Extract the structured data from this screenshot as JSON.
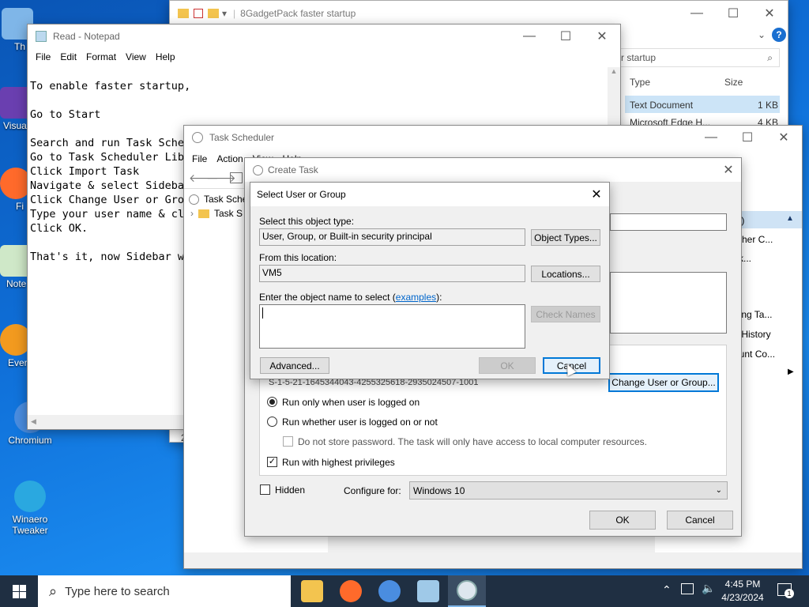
{
  "desktop": {
    "icons": [
      {
        "label": "Th",
        "name": "this-pc"
      },
      {
        "label": "Visua",
        "name": "visual"
      },
      {
        "label": "Fi",
        "name": "firefox"
      },
      {
        "label": "Note",
        "name": "notepad"
      },
      {
        "label": "Ever",
        "name": "everything"
      },
      {
        "label": "Chromium",
        "name": "chromium"
      },
      {
        "label": "Winaero Tweaker",
        "name": "winaero"
      }
    ]
  },
  "explorer": {
    "title": "8GadgetPack faster startup",
    "search": "r startup",
    "col_type": "Type",
    "col_size": "Size",
    "rows": [
      {
        "type": "Text Document",
        "size": "1 KB"
      },
      {
        "type": "Microsoft Edge H...",
        "size": "4 KB"
      }
    ],
    "bottom_fragment": "2"
  },
  "notepad": {
    "title": "Read - Notepad",
    "menu": [
      "File",
      "Edit",
      "Format",
      "View",
      "Help"
    ],
    "lines": [
      "To enable faster startup,",
      "",
      "Go to Start",
      "",
      "Search and run Task Schedul",
      "Go to Task Scheduler Libr",
      "Click Import Task",
      "Navigate & select Sideba",
      "Click Change User or Gro",
      "Type your user name & cl",
      "Click OK.",
      "",
      "That's it, now Sidebar w"
    ]
  },
  "task_scheduler": {
    "title": "Task Scheduler",
    "menu": [
      "File",
      "Action",
      "View",
      "Help"
    ],
    "tree": [
      "Task Sche",
      "Task S"
    ],
    "actions": [
      "al)",
      "other C...",
      "sk...",
      "ning Ta...",
      "s History",
      "ount Co..."
    ]
  },
  "create_task": {
    "title": "Create Task",
    "sid": "S-1-5-21-1645344043-4255325618-2935024507-1001",
    "change_user_label": "Change User or Group...",
    "radio_logged_on": "Run only when user is logged on",
    "radio_whether": "Run whether user is logged on or not",
    "no_store": "Do not store password.  The task will only have access to local computer resources.",
    "highest": "Run with highest privileges",
    "hidden": "Hidden",
    "configure_for_label": "Configure for:",
    "configure_for_value": "Windows 10",
    "ok": "OK",
    "cancel": "Cancel"
  },
  "select_user": {
    "title": "Select User or Group",
    "object_type_label": "Select this object type:",
    "object_type_value": "User, Group, or Built-in security principal",
    "object_types_btn": "Object Types...",
    "location_label": "From this location:",
    "location_value": "VM5",
    "locations_btn": "Locations...",
    "enter_label_prefix": "Enter the object name to select (",
    "enter_label_link": "examples",
    "enter_label_suffix": "):",
    "check_names_btn": "Check Names",
    "advanced_btn": "Advanced...",
    "ok_btn": "OK",
    "cancel_btn": "Cancel"
  },
  "taskbar": {
    "search_placeholder": "Type here to search",
    "time": "4:45 PM",
    "date": "4/23/2024",
    "notif_count": "1"
  }
}
